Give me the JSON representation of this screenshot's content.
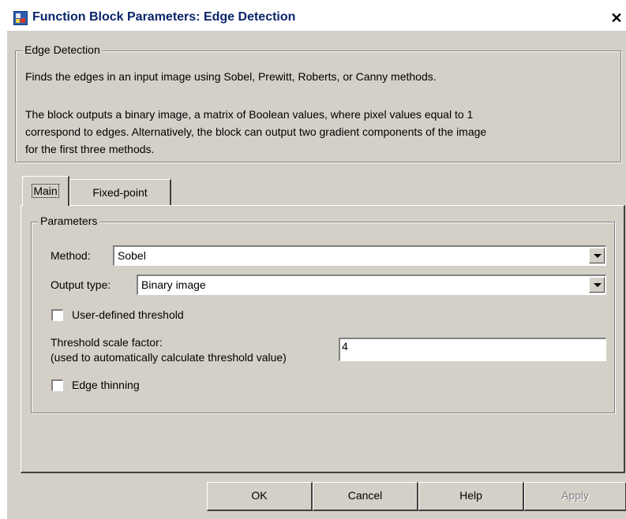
{
  "window": {
    "title": "Function Block Parameters: Edge Detection",
    "close_glyph": "✕",
    "icon": "simulink-block-icon"
  },
  "description": {
    "group_label": "Edge Detection",
    "line1": "Finds the edges in an input image using Sobel, Prewitt, Roberts, or Canny methods.",
    "line2": "The block outputs a binary image, a matrix of Boolean values, where pixel values equal to 1",
    "line3": "correspond to edges.  Alternatively, the block can output two gradient components of the image",
    "line4": "for the first three methods."
  },
  "tabs": [
    {
      "label": "Main",
      "active": true
    },
    {
      "label": "Fixed-point",
      "active": false
    }
  ],
  "parameters": {
    "group_label": "Parameters",
    "method": {
      "label": "Method:",
      "value": "Sobel"
    },
    "output_type": {
      "label": "Output type:",
      "value": "Binary image"
    },
    "user_threshold": {
      "label": "User-defined threshold",
      "checked": false
    },
    "threshold_scale": {
      "label_line1": "Threshold scale factor:",
      "label_line2": "(used to automatically calculate threshold value)",
      "value": "4"
    },
    "edge_thinning": {
      "label": "Edge thinning",
      "checked": false
    }
  },
  "buttons": {
    "ok": "OK",
    "cancel": "Cancel",
    "help": "Help",
    "apply": "Apply"
  }
}
